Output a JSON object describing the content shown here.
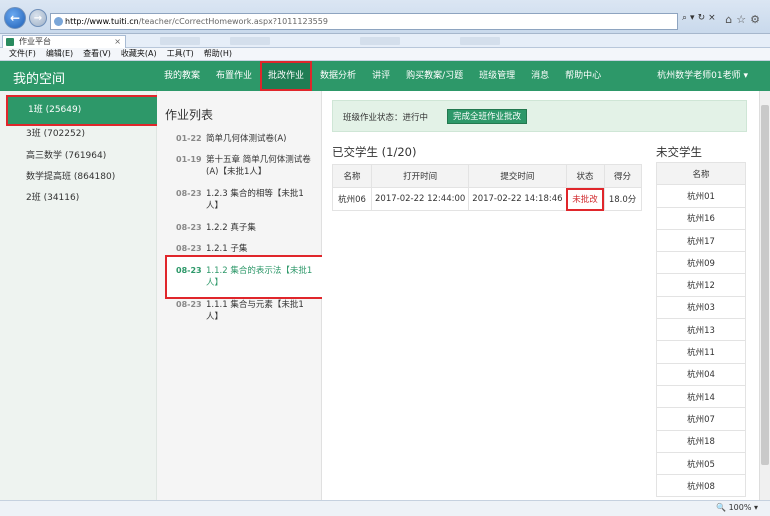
{
  "browser": {
    "url_host": "http://www.tuiti.cn",
    "url_path": "/teacher/cCorrectHomework.aspx?1011123559",
    "tab_title": "作业平台",
    "menu": [
      "文件(F)",
      "编辑(E)",
      "查看(V)",
      "收藏夹(A)",
      "工具(T)",
      "帮助(H)"
    ],
    "zoom": "100%"
  },
  "header": {
    "brand": "我的空间",
    "nav": [
      "我的教案",
      "布置作业",
      "批改作业",
      "数据分析",
      "讲评",
      "购买教案/习题",
      "班级管理",
      "消息",
      "帮助中心"
    ],
    "active_nav": "批改作业",
    "user": "杭州数学老师01老师 ▾"
  },
  "classes": [
    {
      "label": "1班 (25649)",
      "active": true
    },
    {
      "label": "3班 (702252)",
      "active": false
    },
    {
      "label": "高三数学 (761964)",
      "active": false
    },
    {
      "label": "数学提高班 (864180)",
      "active": false
    },
    {
      "label": "2班 (34116)",
      "active": false
    }
  ],
  "homework": {
    "title": "作业列表",
    "items": [
      {
        "date": "01-22",
        "name": "简单几何体测试卷(A)"
      },
      {
        "date": "01-19",
        "name": "第十五章 简单几何体测试卷(A)【未批1人】"
      },
      {
        "date": "08-23",
        "name": "1.2.3 集合的相等【未批1人】"
      },
      {
        "date": "08-23",
        "name": "1.2.2 真子集"
      },
      {
        "date": "08-23",
        "name": "1.2.1 子集"
      },
      {
        "date": "08-23",
        "name": "1.1.2 集合的表示法【未批1人】",
        "active": true
      },
      {
        "date": "08-23",
        "name": "1.1.1 集合与元素【未批1人】"
      }
    ]
  },
  "status": {
    "label": "班级作业状态：进行中",
    "button": "完成全班作业批改"
  },
  "submitted": {
    "title": "已交学生 (1/20)",
    "columns": [
      "名称",
      "打开时间",
      "提交时间",
      "状态",
      "得分"
    ],
    "rows": [
      [
        "杭州06",
        "2017-02-22 12:44:00",
        "2017-02-22 14:18:46",
        "未批改",
        "18.0分"
      ]
    ]
  },
  "pending": {
    "title": "未交学生",
    "column": "名称",
    "students": [
      "杭州01",
      "杭州16",
      "杭州17",
      "杭州09",
      "杭州12",
      "杭州03",
      "杭州13",
      "杭州11",
      "杭州04",
      "杭州14",
      "杭州07",
      "杭州18",
      "杭州05",
      "杭州08"
    ]
  }
}
